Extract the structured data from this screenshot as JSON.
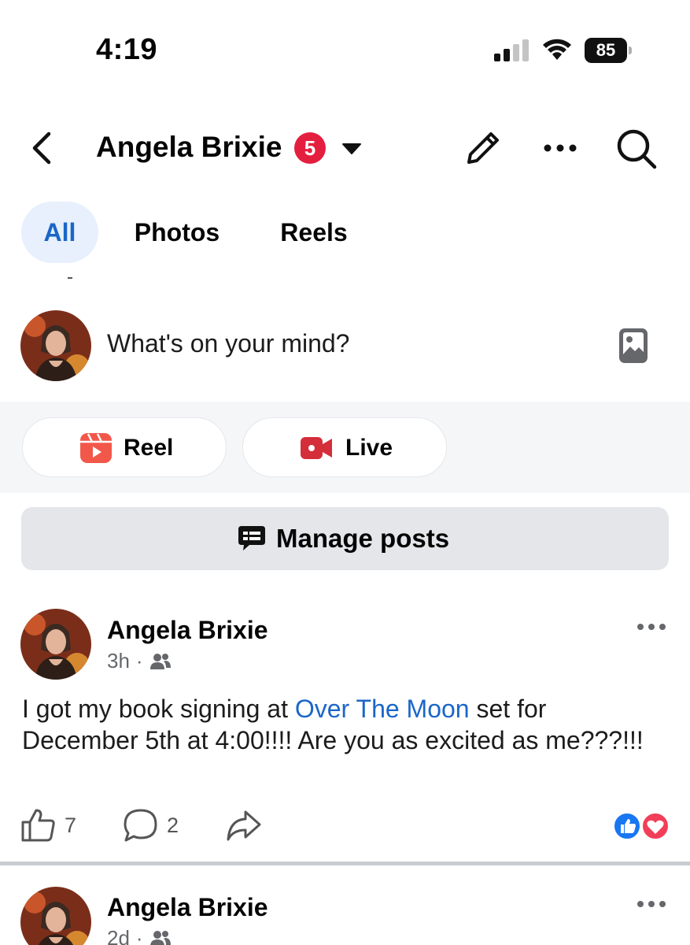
{
  "status_bar": {
    "time": "4:19",
    "battery": "85",
    "icons": [
      "signal-icon",
      "wifi-icon",
      "battery-icon"
    ]
  },
  "header": {
    "title": "Angela Brixie",
    "badge_count": "5",
    "icons": [
      "back-icon",
      "chevron-down-icon",
      "pencil-icon",
      "more-icon",
      "search-icon"
    ]
  },
  "tabs": [
    {
      "label": "All",
      "active": true
    },
    {
      "label": "Photos",
      "active": false
    },
    {
      "label": "Reels",
      "active": false
    }
  ],
  "composer": {
    "placeholder": "What's on your mind?",
    "icon": "photo-icon"
  },
  "quick_actions": [
    {
      "label": "Reel",
      "icon": "reel-icon",
      "color": "#f2584a"
    },
    {
      "label": "Live",
      "icon": "live-video-icon",
      "color": "#d32e3a"
    }
  ],
  "manage_posts": {
    "label": "Manage posts",
    "icon": "manage-posts-icon"
  },
  "posts": [
    {
      "author": "Angela Brixie",
      "time": "3h",
      "separator": "·",
      "audience_icon": "friends-icon",
      "text_before_link": "I got my book signing at ",
      "link_text": "Over The Moon",
      "text_after_link": " set for December 5th at 4:00!!!! Are you as excited as me???!!!",
      "like_count": "7",
      "comment_count": "2",
      "reactions": [
        "like-reaction-icon",
        "love-reaction-icon"
      ]
    },
    {
      "author": "Angela Brixie",
      "time": "2d",
      "separator": "·",
      "audience_icon": "friends-icon"
    }
  ],
  "colors": {
    "accent_blue": "#1b66c9",
    "active_tab_bg": "#e7f0fc",
    "badge_red": "#e41e3f",
    "manage_bg": "#e4e6ea",
    "meta_gray": "#65676b"
  }
}
